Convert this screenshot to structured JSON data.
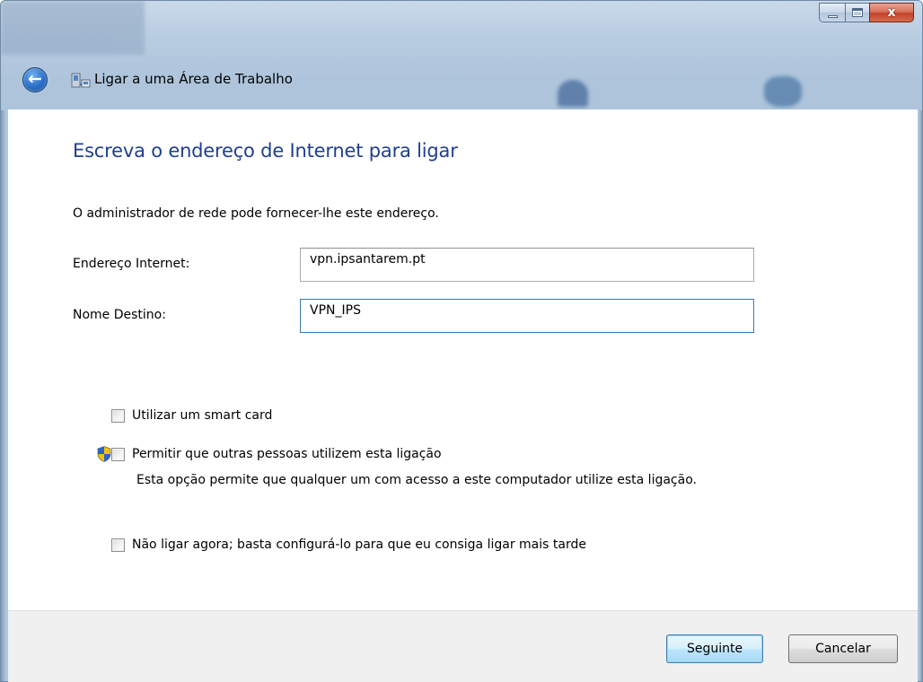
{
  "window": {
    "title": "Ligar a uma Área de Trabalho",
    "close_glyph": "x"
  },
  "icons": {
    "back": "back-arrow-icon",
    "app": "network-connection-icon",
    "minimize": "minimize-icon",
    "maximize": "maximize-icon",
    "close": "close-icon",
    "shield": "uac-shield-icon"
  },
  "main": {
    "heading": "Escreva o endereço de Internet para ligar",
    "description": "O administrador de rede pode fornecer-lhe este endereço.",
    "fields": {
      "address_label": "Endereço Internet:",
      "address_value": "vpn.ipsantarem.pt",
      "destination_label": "Nome Destino:",
      "destination_value": "VPN_IPS"
    },
    "options": [
      {
        "label": "Utilizar um smart card",
        "checked": false
      },
      {
        "label": "Permitir que outras pessoas utilizem esta ligação",
        "checked": false
      },
      {
        "label": "Não ligar agora; basta configurá-lo para que eu consiga ligar mais tarde",
        "checked": false
      }
    ],
    "allow_others_note": "Esta opção permite que qualquer um com acesso a este computador utilize esta ligação."
  },
  "footer": {
    "next_label": "Seguinte",
    "cancel_label": "Cancelar"
  },
  "colors": {
    "heading": "#1f3f8f",
    "primary_button_border": "#3c7fb1",
    "close_button": "#c2432b"
  }
}
